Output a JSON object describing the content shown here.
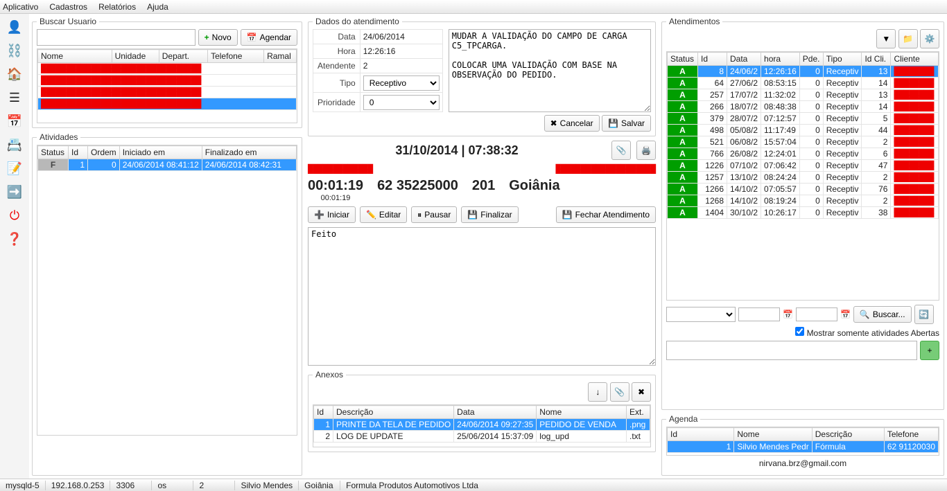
{
  "menus": {
    "aplicativo": "Aplicativo",
    "cadastros": "Cadastros",
    "relatorios": "Relatórios",
    "ajuda": "Ajuda"
  },
  "busca": {
    "title": "Buscar Usuario",
    "novo": "Novo",
    "agendar": "Agendar",
    "headers": {
      "nome": "Nome",
      "unidade": "Unidade",
      "depart": "Depart.",
      "telefone": "Telefone",
      "ramal": "Ramal"
    }
  },
  "atividades": {
    "title": "Atividades",
    "headers": {
      "status": "Status",
      "id": "Id",
      "ordem": "Ordem",
      "iniciado": "Iniciado em",
      "finalizado": "Finalizado em"
    },
    "rows": [
      {
        "status": "F",
        "id": "1",
        "ordem": "0",
        "ini": "24/06/2014 08:41:12",
        "fin": "24/06/2014 08:42:31"
      }
    ]
  },
  "dados": {
    "title": "Dados do atendimento",
    "labels": {
      "data": "Data",
      "hora": "Hora",
      "atendente": "Atendente",
      "tipo": "Tipo",
      "prioridade": "Prioridade"
    },
    "values": {
      "data": "24/06/2014",
      "hora": "12:26:16",
      "atendente": "2",
      "tipo": "Receptivo",
      "prioridade": "0"
    },
    "obs": "MUDAR A VALIDAÇÃO DO CAMPO DE CARGA C5_TPCARGA.\n\nCOLOCAR UMA VALIDAÇÃO COM BASE NA OBSERVAÇÃO DO PEDIDO.",
    "cancelar": "Cancelar",
    "salvar": "Salvar"
  },
  "painel": {
    "datetime": "31/10/2014 | 07:38:32",
    "timer": "00:01:19",
    "timer2": "00:01:19",
    "telefone": "62 35225000",
    "ramal": "201",
    "cidade": "Goiânia",
    "iniciar": "Iniciar",
    "editar": "Editar",
    "pausar": "Pausar",
    "finalizar": "Finalizar",
    "fechar": "Fechar Atendimento",
    "nota": "Feito"
  },
  "anexos": {
    "title": "Anexos",
    "headers": {
      "id": "Id",
      "desc": "Descrição",
      "data": "Data",
      "nome": "Nome",
      "ext": "Ext."
    },
    "rows": [
      {
        "id": "1",
        "desc": "PRINTE DA TELA DE PEDIDO",
        "data": "24/06/2014 09:27:35",
        "nome": "PEDIDO DE VENDA",
        "ext": ".png"
      },
      {
        "id": "2",
        "desc": "LOG DE UPDATE",
        "data": "25/06/2014 15:37:09",
        "nome": "log_upd",
        "ext": ".txt"
      }
    ]
  },
  "atend": {
    "title": "Atendimentos",
    "headers": {
      "status": "Status",
      "id": "Id",
      "data": "Data",
      "hora": "hora",
      "pde": "Pde.",
      "tipo": "Tipo",
      "idcli": "Id Cli.",
      "cliente": "Cliente"
    },
    "rows": [
      {
        "s": "A",
        "id": "8",
        "data": "24/06/2",
        "hora": "12:26:16",
        "pde": "0",
        "tipo": "Receptiv",
        "idcli": "13",
        "sel": true
      },
      {
        "s": "A",
        "id": "64",
        "data": "27/06/2",
        "hora": "08:53:15",
        "pde": "0",
        "tipo": "Receptiv",
        "idcli": "14"
      },
      {
        "s": "A",
        "id": "257",
        "data": "17/07/2",
        "hora": "11:32:02",
        "pde": "0",
        "tipo": "Receptiv",
        "idcli": "13"
      },
      {
        "s": "A",
        "id": "266",
        "data": "18/07/2",
        "hora": "08:48:38",
        "pde": "0",
        "tipo": "Receptiv",
        "idcli": "14"
      },
      {
        "s": "A",
        "id": "379",
        "data": "28/07/2",
        "hora": "07:12:57",
        "pde": "0",
        "tipo": "Receptiv",
        "idcli": "5"
      },
      {
        "s": "A",
        "id": "498",
        "data": "05/08/2",
        "hora": "11:17:49",
        "pde": "0",
        "tipo": "Receptiv",
        "idcli": "44"
      },
      {
        "s": "A",
        "id": "521",
        "data": "06/08/2",
        "hora": "15:57:04",
        "pde": "0",
        "tipo": "Receptiv",
        "idcli": "2"
      },
      {
        "s": "A",
        "id": "766",
        "data": "26/08/2",
        "hora": "12:24:01",
        "pde": "0",
        "tipo": "Receptiv",
        "idcli": "6"
      },
      {
        "s": "A",
        "id": "1226",
        "data": "07/10/2",
        "hora": "07:06:42",
        "pde": "0",
        "tipo": "Receptiv",
        "idcli": "47"
      },
      {
        "s": "A",
        "id": "1257",
        "data": "13/10/2",
        "hora": "08:24:24",
        "pde": "0",
        "tipo": "Receptiv",
        "idcli": "2"
      },
      {
        "s": "A",
        "id": "1266",
        "data": "14/10/2",
        "hora": "07:05:57",
        "pde": "0",
        "tipo": "Receptiv",
        "idcli": "76"
      },
      {
        "s": "A",
        "id": "1268",
        "data": "14/10/2",
        "hora": "08:19:24",
        "pde": "0",
        "tipo": "Receptiv",
        "idcli": "2"
      },
      {
        "s": "A",
        "id": "1404",
        "data": "30/10/2",
        "hora": "10:26:17",
        "pde": "0",
        "tipo": "Receptiv",
        "idcli": "38"
      }
    ],
    "buscar": "Buscar...",
    "mostrar": "Mostrar somente atividades Abertas"
  },
  "agenda": {
    "title": "Agenda",
    "headers": {
      "id": "Id",
      "nome": "Nome",
      "desc": "Descrição",
      "tel": "Telefone"
    },
    "rows": [
      {
        "id": "1",
        "nome": "Silvio Mendes Pedr",
        "desc": "Fórmula",
        "tel": "62 91120030"
      }
    ],
    "email": "nirvana.brz@gmail.com"
  },
  "status": {
    "db": "mysqld-5",
    "ip": "192.168.0.253",
    "port": "3306",
    "os": "os",
    "n": "2",
    "user": "Silvio Mendes",
    "cidade": "Goiânia",
    "empresa": "Formula Produtos Automotivos Ltda"
  }
}
